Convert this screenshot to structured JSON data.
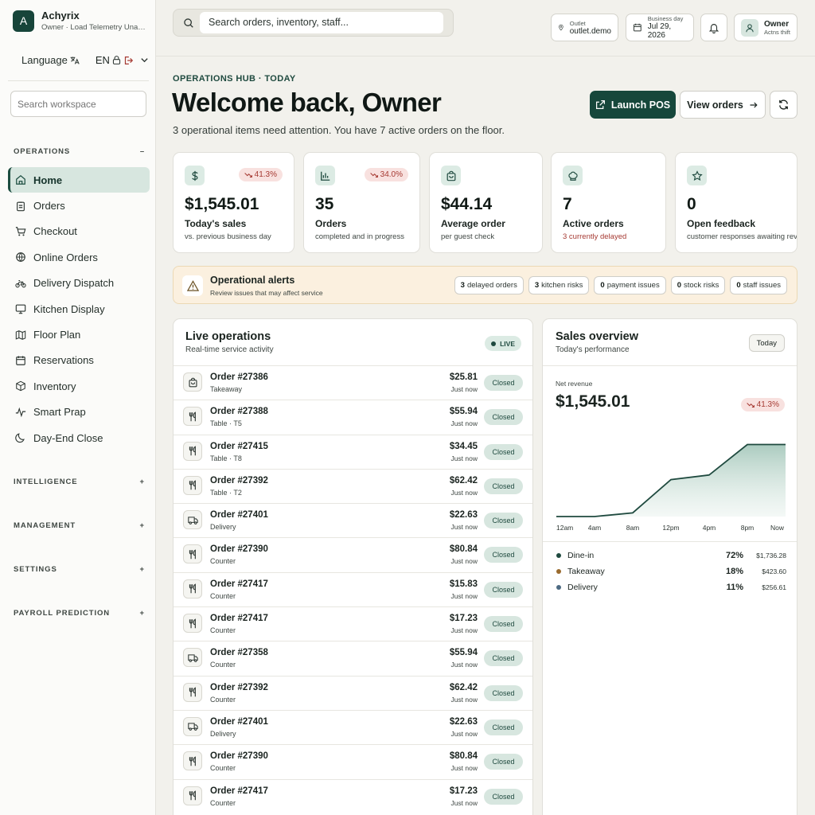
{
  "brand": {
    "logo_letter": "A",
    "name": "Achyrix",
    "subtitle": "Owner · Load Telemetry Unavail..."
  },
  "sidebar": {
    "language_label": "Language",
    "language_code": "EN",
    "search_placeholder": "Search workspace",
    "operations_header": "OPERATIONS",
    "operations_toggle": "–",
    "items": [
      {
        "label": "Home",
        "icon": "home-icon",
        "active": true
      },
      {
        "label": "Orders",
        "icon": "clipboard-icon"
      },
      {
        "label": "Checkout",
        "icon": "cart-icon"
      },
      {
        "label": "Online Orders",
        "icon": "globe-icon"
      },
      {
        "label": "Delivery Dispatch",
        "icon": "bike-icon"
      },
      {
        "label": "Kitchen Display",
        "icon": "monitor-icon"
      },
      {
        "label": "Floor Plan",
        "icon": "map-icon"
      },
      {
        "label": "Reservations",
        "icon": "calendar-icon"
      },
      {
        "label": "Inventory",
        "icon": "box-icon"
      },
      {
        "label": "Smart Prap",
        "icon": "activity-icon"
      },
      {
        "label": "Day-End Close",
        "icon": "moon-icon"
      }
    ],
    "sections": [
      {
        "label": "INTELLIGENCE",
        "toggle": "+"
      },
      {
        "label": "MANAGEMENT",
        "toggle": "+"
      },
      {
        "label": "SETTINGS",
        "toggle": "+"
      },
      {
        "label": "PAYROLL PREDICTION",
        "toggle": "+"
      }
    ]
  },
  "topbar": {
    "search_placeholder": "Search orders, inventory, staff...",
    "outlet_label": "Outlet",
    "outlet_value": "outlet.demo",
    "business_day_label": "Business day",
    "business_day_value": "Jul 29, 2026",
    "user_name": "Owner",
    "user_status": "Actns thift"
  },
  "header": {
    "eyebrow": "OPERATIONS HUB · TODAY",
    "title": "Welcome back, Owner",
    "subtitle": "3 operational items need attention. You have 7 active orders on the floor.",
    "launch_pos": "Launch POS",
    "view_orders": "View orders"
  },
  "kpis": [
    {
      "value": "$1,545.01",
      "label": "Today's sales",
      "desc": "vs. previous business day",
      "delta": "41.3%",
      "icon": "dollar-icon"
    },
    {
      "value": "35",
      "label": "Orders",
      "desc": "completed and in progress",
      "delta": "34.0%",
      "icon": "bar-chart-icon"
    },
    {
      "value": "$44.14",
      "label": "Average order",
      "desc": "per guest check",
      "icon": "bag-icon"
    },
    {
      "value": "7",
      "label": "Active orders",
      "desc": "3 currently delayed",
      "icon": "chef-hat-icon"
    },
    {
      "value": "0",
      "label": "Open feedback",
      "desc": "customer responses awaiting review",
      "icon": "star-icon"
    }
  ],
  "alerts": {
    "title": "Operational alerts",
    "subtitle": "Review issues that may affect service",
    "pills": [
      {
        "count": "3",
        "label": "delayed orders"
      },
      {
        "count": "3",
        "label": "kitchen risks"
      },
      {
        "count": "0",
        "label": "payment issues"
      },
      {
        "count": "0",
        "label": "stock risks"
      },
      {
        "count": "0",
        "label": "staff issues"
      }
    ]
  },
  "live": {
    "title": "Live operations",
    "subtitle": "Real-time service activity",
    "badge": "LIVE",
    "orders": [
      {
        "name": "Order #27386",
        "type": "Takeaway",
        "amount": "$25.81",
        "time": "Just now",
        "status": "Closed",
        "icon": "bag-icon"
      },
      {
        "name": "Order #27388",
        "type": "Table · T5",
        "amount": "$55.94",
        "time": "Just now",
        "status": "Closed",
        "icon": "utensils-icon"
      },
      {
        "name": "Order #27415",
        "type": "Table · T8",
        "amount": "$34.45",
        "time": "Just now",
        "status": "Closed",
        "icon": "utensils-icon"
      },
      {
        "name": "Order #27392",
        "type": "Table · T2",
        "amount": "$62.42",
        "time": "Just now",
        "status": "Closed",
        "icon": "utensils-icon"
      },
      {
        "name": "Order #27401",
        "type": "Delivery",
        "amount": "$22.63",
        "time": "Just now",
        "status": "Closed",
        "icon": "truck-icon"
      },
      {
        "name": "Order #27390",
        "type": "Counter",
        "amount": "$80.84",
        "time": "Just now",
        "status": "Closed",
        "icon": "utensils-icon"
      },
      {
        "name": "Order #27417",
        "type": "Counter",
        "amount": "$15.83",
        "time": "Just now",
        "status": "Closed",
        "icon": "utensils-icon"
      },
      {
        "name": "Order #27417",
        "type": "Counter",
        "amount": "$17.23",
        "time": "Just now",
        "status": "Closed",
        "icon": "utensils-icon"
      },
      {
        "name": "Order #27358",
        "type": "Counter",
        "amount": "$55.94",
        "time": "Just now",
        "status": "Closed",
        "icon": "truck-icon"
      },
      {
        "name": "Order #27392",
        "type": "Counter",
        "amount": "$62.42",
        "time": "Just now",
        "status": "Closed",
        "icon": "utensils-icon"
      },
      {
        "name": "Order #27401",
        "type": "Delivery",
        "amount": "$22.63",
        "time": "Just now",
        "status": "Closed",
        "icon": "truck-icon"
      },
      {
        "name": "Order #27390",
        "type": "Counter",
        "amount": "$80.84",
        "time": "Just now",
        "status": "Closed",
        "icon": "utensils-icon"
      },
      {
        "name": "Order #27417",
        "type": "Counter",
        "amount": "$17.23",
        "time": "Just now",
        "status": "Closed",
        "icon": "utensils-icon"
      }
    ]
  },
  "sales": {
    "title": "Sales overview",
    "subtitle": "Today's performance",
    "range": "Today",
    "net_label": "Net revenue",
    "net_value": "$1,545.01",
    "net_delta": "41.3%",
    "breakdown": [
      {
        "name": "Dine-in",
        "pct": "72%",
        "amount": "$1,736.28",
        "color": "#1f4a3f"
      },
      {
        "name": "Takeaway",
        "pct": "18%",
        "amount": "$423.60",
        "color": "#9a6b2e"
      },
      {
        "name": "Delivery",
        "pct": "11%",
        "amount": "$256.61",
        "color": "#4d6a82"
      }
    ]
  },
  "chart_data": {
    "type": "area",
    "x": [
      "12am",
      "4am",
      "8am",
      "12pm",
      "4pm",
      "8pm",
      "Now"
    ],
    "xlabel": "",
    "ylabel": "",
    "grid": false,
    "legend": "none",
    "series": [
      {
        "values": [
          0,
          0,
          4,
          40,
          45,
          78,
          78
        ]
      }
    ],
    "ylim": [
      0,
      100
    ]
  },
  "colors": {
    "accent": "#16473b",
    "accent_soft": "#d7e6df",
    "negative": "#a63a33",
    "alert_bg": "#fbf0df",
    "page_bg": "#f2f1ec"
  }
}
